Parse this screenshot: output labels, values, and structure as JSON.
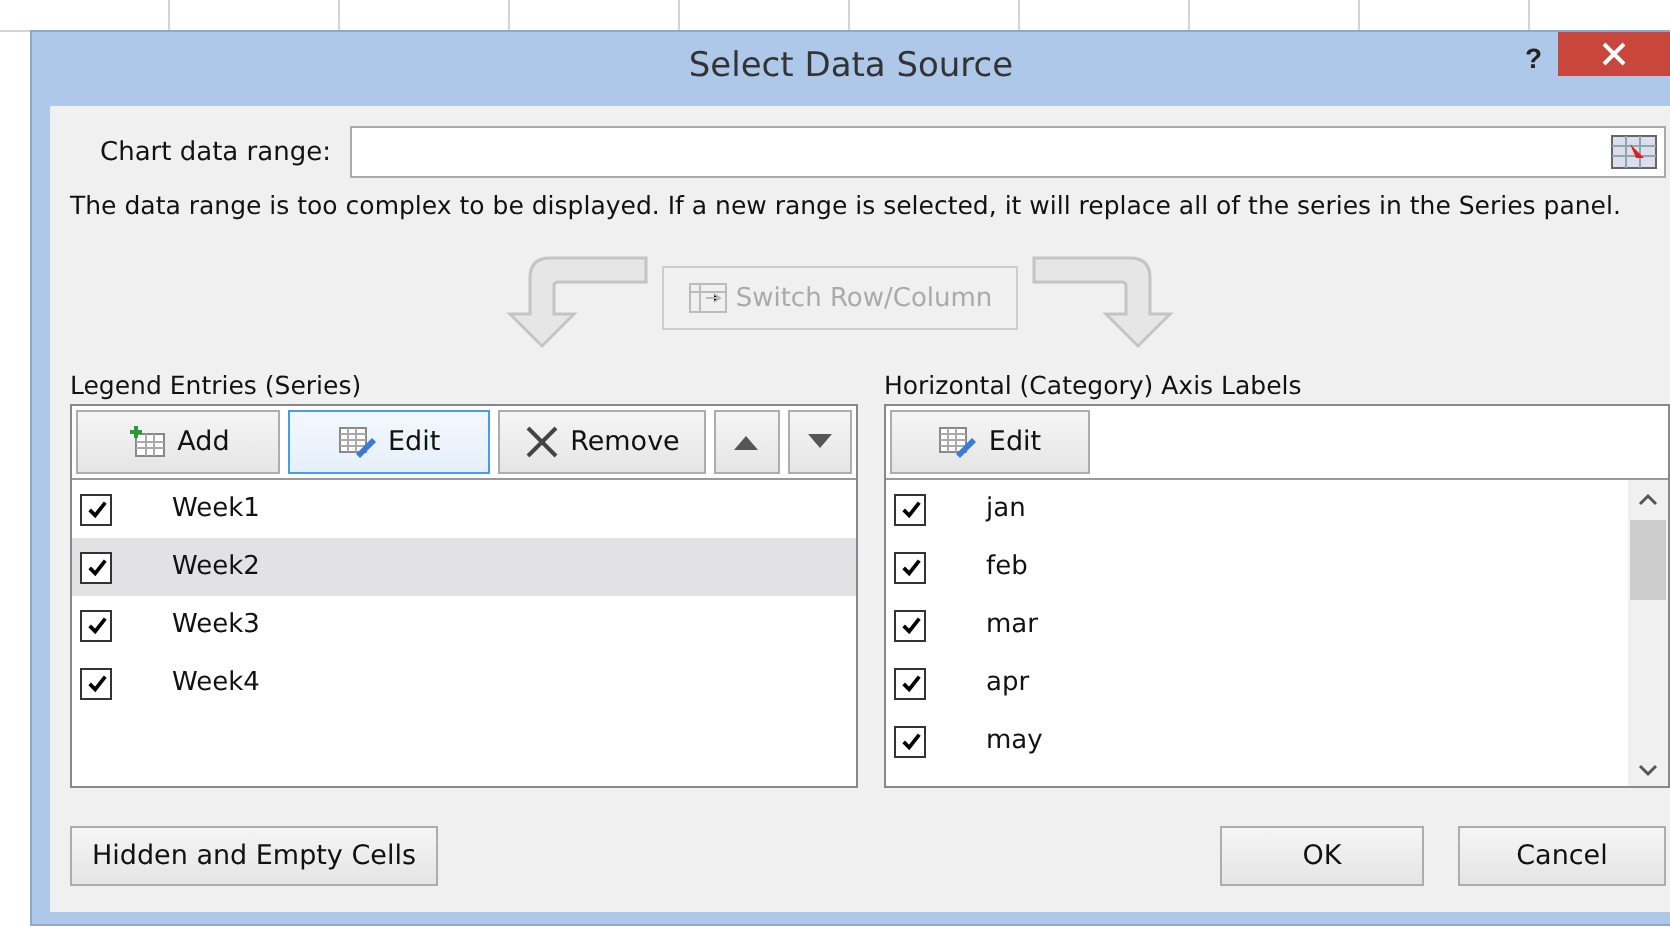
{
  "window": {
    "title": "Select Data Source",
    "help": "?"
  },
  "data_range": {
    "label": "Chart data range:"
  },
  "message": "The data range is too complex to be displayed. If a new range is selected, it will replace all of the series in the Series panel.",
  "switch_button": {
    "label": "Switch Row/Column",
    "disabled": true
  },
  "legend": {
    "label": "Legend Entries (Series)",
    "toolbar": [
      {
        "kind": "add",
        "label": "Add",
        "focused": false
      },
      {
        "kind": "edit",
        "label": "Edit",
        "focused": true
      },
      {
        "kind": "remove",
        "label": "Remove",
        "focused": false
      },
      {
        "kind": "up",
        "focused": false
      },
      {
        "kind": "down",
        "focused": false
      }
    ],
    "items": [
      {
        "label": "Week1",
        "checked": true,
        "selected": false
      },
      {
        "label": "Week2",
        "checked": true,
        "selected": true
      },
      {
        "label": "Week3",
        "checked": true,
        "selected": false
      },
      {
        "label": "Week4",
        "checked": true,
        "selected": false
      }
    ]
  },
  "axis": {
    "label": "Horizontal (Category) Axis Labels",
    "edit_button": "Edit",
    "items": [
      {
        "label": "jan",
        "checked": true
      },
      {
        "label": "feb",
        "checked": true
      },
      {
        "label": "mar",
        "checked": true
      },
      {
        "label": "apr",
        "checked": true
      },
      {
        "label": "may",
        "checked": true
      }
    ]
  },
  "buttons": {
    "hidden_cells": "Hidden and Empty Cells",
    "ok": "OK",
    "cancel": "Cancel"
  }
}
